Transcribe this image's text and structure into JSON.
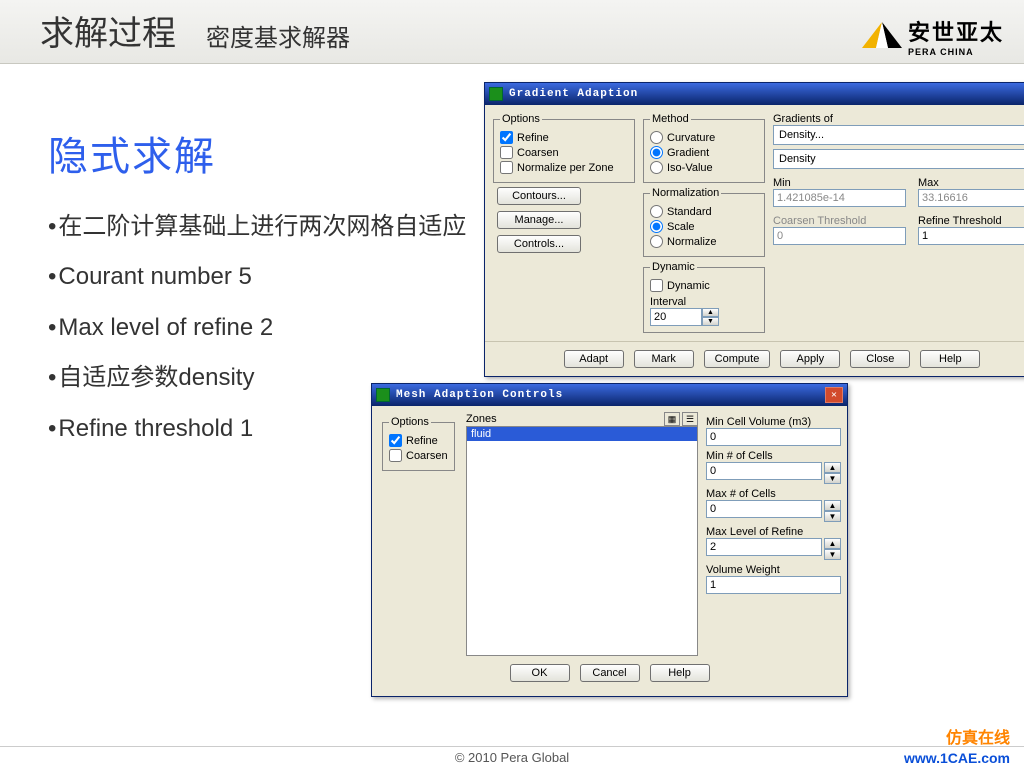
{
  "header": {
    "title": "求解过程",
    "subtitle": "密度基求解器",
    "logo_cn": "安世亚太",
    "logo_en": "PERA CHINA"
  },
  "slide": {
    "bigtitle": "隐式求解",
    "bullets": [
      "在二阶计算基础上进行两次网格自适应",
      "Courant number 5",
      "Max level of refine 2",
      "自适应参数density",
      "Refine threshold 1"
    ]
  },
  "w1": {
    "title": "Gradient Adaption",
    "options_legend": "Options",
    "opt_refine": "Refine",
    "opt_coarsen": "Coarsen",
    "opt_norm": "Normalize per Zone",
    "btn_contours": "Contours...",
    "btn_manage": "Manage...",
    "btn_controls": "Controls...",
    "method_legend": "Method",
    "m_curv": "Curvature",
    "m_grad": "Gradient",
    "m_iso": "Iso-Value",
    "norm_legend": "Normalization",
    "n_std": "Standard",
    "n_scale": "Scale",
    "n_norm": "Normalize",
    "dyn_legend": "Dynamic",
    "dyn_chk": "Dynamic",
    "dyn_int": "Interval",
    "dyn_val": "20",
    "gradof": "Gradients of",
    "gradsel1": "Density...",
    "gradsel2": "Density",
    "min_l": "Min",
    "max_l": "Max",
    "min_v": "1.421085e-14",
    "max_v": "33.16616",
    "ct_l": "Coarsen Threshold",
    "rt_l": "Refine Threshold",
    "ct_v": "0",
    "rt_v": "1",
    "btns": {
      "adapt": "Adapt",
      "mark": "Mark",
      "compute": "Compute",
      "apply": "Apply",
      "close": "Close",
      "help": "Help"
    }
  },
  "w2": {
    "title": "Mesh Adaption Controls",
    "options_legend": "Options",
    "opt_refine": "Refine",
    "opt_coarsen": "Coarsen",
    "zones_legend": "Zones",
    "zone_item": "fluid",
    "mincv_l": "Min Cell Volume (m3)",
    "mincv_v": "0",
    "minc_l": "Min # of Cells",
    "minc_v": "0",
    "maxc_l": "Max # of Cells",
    "maxc_v": "0",
    "mlr_l": "Max Level of Refine",
    "mlr_v": "2",
    "vw_l": "Volume Weight",
    "vw_v": "1",
    "btns": {
      "ok": "OK",
      "cancel": "Cancel",
      "help": "Help"
    }
  },
  "footer": {
    "copy": "© 2010 Pera Global",
    "wmtitle": "仿真在线",
    "wmsite": "www.1CAE.com"
  }
}
